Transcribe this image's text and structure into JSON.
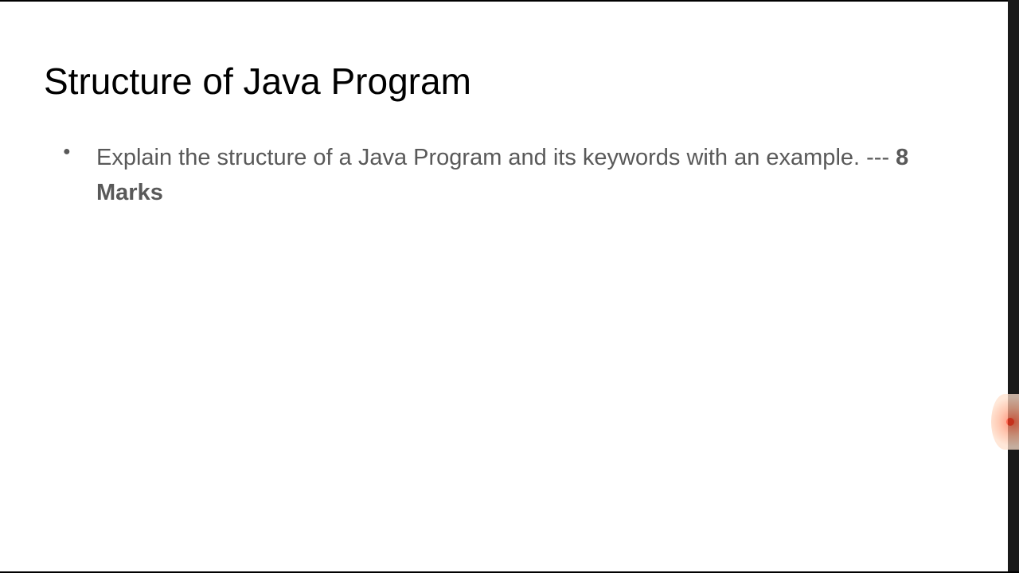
{
  "slide": {
    "title": "Structure of Java Program",
    "bullets": [
      {
        "text": "Explain the structure of a Java Program and its keywords with an example. --- ",
        "marks": "8 Marks"
      }
    ]
  }
}
